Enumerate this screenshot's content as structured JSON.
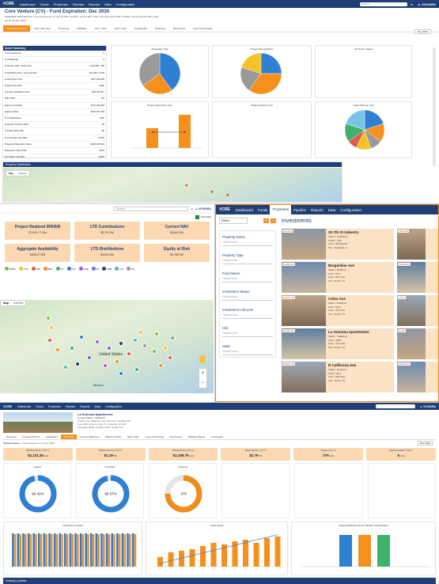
{
  "s1": {
    "nav_brand": "VCRE",
    "nav": [
      "Dashboard",
      "Funds",
      "Properties",
      "Pipeline",
      "Reports",
      "Data",
      "Configuration"
    ],
    "search_placeholder": "Search",
    "title": "Core Venture (CV) - Fund Expiration: Dec 2030",
    "line1_label": "Fund Size:",
    "line1_value": "$169.9M NAV",
    "line1_rest": "• # of Investments: 5 • Net LP IRR: 10.25% • Net LP EM: 2.22x • Net Enterprise IRR: 10.89% • Net Enterprise EM: 2.29x",
    "asof_label": "As of:",
    "asof_value": "31-Dec-2023",
    "tabs": [
      "Portfolio Overview",
      "Exec Summary",
      "Pro-forma",
      "Cashflow",
      "Cont. / Dist.",
      "NAV / GAV",
      "Investments",
      "Financing",
      "Documents",
      "Fund Commentary"
    ],
    "period": "Dec-2023",
    "asset_summary_title": "Asset Summary",
    "rows": [
      [
        "# of Investments",
        "5"
      ],
      [
        "# of Buildings",
        "8"
      ],
      [
        "Total Size (SF) / Total Units",
        "1,012,000 / 799"
      ],
      [
        "Avg Building Size / Avg Unit Size",
        "201,900 / 1,250"
      ],
      [
        "Total Project Cost",
        "$227,000,000"
      ],
      [
        "Project Cost PSF",
        "$182"
      ],
      [
        "Average Acquisition Cost",
        "$87,645,117"
      ],
      [
        "IRR (70%)",
        "9%"
      ],
      [
        "Equity Committed",
        "$172,100,000"
      ],
      [
        "Equity at Risk",
        "$101,817,459"
      ],
      [
        "% of Total Equity",
        "59%"
      ],
      [
        "Projected Transfer Value",
        "$0"
      ],
      [
        "Transfer Value PSF",
        "$0"
      ],
      [
        "W.A Transfer Cap Rate",
        "0.00%"
      ],
      [
        "Projected Disposition Value",
        "$425,369,591"
      ],
      [
        "Disposition Value PSF",
        "$341"
      ],
      [
        "W.A Dispo Cap Rate",
        "4.69%"
      ],
      [
        "Current Leased %",
        "99%"
      ]
    ],
    "chart_titles": [
      "Acquisition Year",
      "Project Diversification",
      "LW Comb. Status",
      "Project Disposition Year",
      "Project Delivery Year",
      "Lease Maturity Year"
    ],
    "property_distribution": "Property Distribution",
    "map_tabs": [
      "Map",
      "Satellite"
    ]
  },
  "s2": {
    "search_placeholder": "Search",
    "date": "Feb-2024",
    "kpis": [
      {
        "label": "Project Realized IRR/EM",
        "value": "33.44% / 1.30x"
      },
      {
        "label": "LTD Contributions",
        "value": "$5,791.9M"
      },
      {
        "label": "Current NAV",
        "value": "$3,663.9M"
      },
      {
        "label": "Aggregate Availability",
        "value": "$996.07 MM"
      },
      {
        "label": "LTD Distributions",
        "value": "$4,684.9M"
      },
      {
        "label": "Equity at Risk",
        "value": "$3,785.9M"
      }
    ],
    "legend": [
      "WMH",
      "CCV",
      "HM",
      "BRF",
      "GL",
      "ICV",
      "HKE",
      "IIF",
      "APB",
      "FIA",
      "NA"
    ],
    "map_tabs": [
      "Map",
      "Satellite"
    ],
    "map_labels": [
      "United States",
      "Mexico"
    ],
    "zoom_in": "+",
    "zoom_out": "−"
  },
  "s3": {
    "nav_brand": "VCRE",
    "nav": [
      "Dashboard",
      "Funds",
      "Properties",
      "Pipeline",
      "Reports",
      "Data",
      "Configuration"
    ],
    "select": "Select",
    "filters": [
      {
        "label": "Property Name",
        "placeholder": "Search here..."
      },
      {
        "label": "Property Type",
        "placeholder": "Search here..."
      },
      {
        "label": "Fund Name",
        "placeholder": "Search here..."
      },
      {
        "label": "Investment Status",
        "placeholder": "Search here..."
      },
      {
        "label": "Investment Lifecycle",
        "placeholder": "Search here..."
      },
      {
        "label": "City",
        "placeholder": "Search here..."
      },
      {
        "label": "State",
        "placeholder": "Search here..."
      }
    ],
    "heading": "Investments",
    "cards": [
      {
        "badge": "Industrial",
        "name": "20 7th St Industry",
        "status": "Status : Stabilized",
        "fund": "Funds : CCV",
        "area": "Area : 400,404 SF",
        "city": "City : Northlake, IL"
      },
      {
        "badge": "Multifamily",
        "name": "Bergenline Ave",
        "status": "Status : Realized",
        "fund": "Fund : NA II",
        "area": "Area : 334 Units",
        "city": "City : Austin, TX"
      },
      {
        "badge": "Multifamily",
        "name": "Coles Ave",
        "status": "Status : Realized",
        "fund": "Fund : NA II",
        "area": "Area : 370 Units",
        "city": "City : Austin, TX"
      },
      {
        "badge": "Multifamily",
        "name": "La Sonoma Apartments",
        "status": "Status : Stabilized",
        "fund": "Fund : HMS",
        "area": "Area : 370 Units",
        "city": "City : Austin, TX"
      },
      {
        "badge": "Multifamily",
        "name": "N California Ave",
        "status": "Status : Realized",
        "fund": "Fund : NA II",
        "area": "Area : 248 Units",
        "city": "City : Austin, TX"
      }
    ],
    "side_badges": [
      "Industrial",
      "Multifamily",
      "Office",
      "Retail",
      "Multifamily"
    ]
  },
  "s4": {
    "nav_brand": "VCRE",
    "nav": [
      "Dashboard",
      "Funds",
      "Properties",
      "Pipeline",
      "Reports",
      "Data",
      "Configuration"
    ],
    "prop_name": "La Sonoma Apartments",
    "prop_status": "Current Status : Stabilized",
    "prop_lines": [
      "Property Type: Multifamily • Size: 370 Units • Year Built: 2021",
      "Fund: HMS • Address: Austin, TX • Acquisition: Q4 2021",
      "Total Equity: $8.9M • Net IRR: 13.4% • Net EM: 1.6x"
    ],
    "tabs": [
      "Overview",
      "Property Metrics",
      "Acquisition",
      "Rent Roll",
      "Income Statement",
      "Balance Sheet",
      "NAV / GAV",
      "Loan & Financing",
      "Documents",
      "Building Photos",
      "Comments"
    ],
    "active_tab": "Rent Roll",
    "tenant_leases": "Tenant Leases",
    "tenant_leases_sub": "Lease Data as of 31-Dec-2023",
    "period": "Dec-2024",
    "kpis": [
      {
        "label": "Effective Rent/u (>1/2 Yr)",
        "value": "$2,121.45",
        "unit": "/unit"
      },
      {
        "label": "Effective Rent/u (>1/2 Yr)",
        "value": "$2.19",
        "unit": "/SF"
      },
      {
        "label": "Market Rent/u (>1/2 Yr)",
        "value": "$2,188.75",
        "unit": "/unit"
      },
      {
        "label": "Market Rent/u (>1/2 Yr)",
        "value": "$2.79",
        "unit": "/SF"
      },
      {
        "label": "Leases (>1/2 Yr)",
        "value": "375",
        "unit": "units"
      },
      {
        "label": "Expired Leases (>1/2 Yr)",
        "value": "6",
        "unit": "units"
      }
    ],
    "gauges": [
      {
        "label": "Leased",
        "value": "96.42%",
        "pct": 0.9642,
        "color": "#2f7fd3"
      },
      {
        "label": "Occupied",
        "value": "96.57%",
        "pct": 0.9657,
        "color": "#2f7fd3"
      },
      {
        "label": "Expiring",
        "value": "379",
        "pct": 0.75,
        "color": "#f08c1c"
      }
    ],
    "chart1": {
      "title": "Occupancy Leased",
      "legend": [
        "Leased",
        "Occupied"
      ]
    },
    "chart2": {
      "title": "Lease Expiry",
      "legend": [
        "Units",
        "Cumulative"
      ]
    },
    "chart3": {
      "title": "Existing Effective Rent to Market Leasing Rent",
      "legend": [
        "Effective",
        "Market",
        "Concession"
      ]
    },
    "footer": "Leasing Updates"
  }
}
